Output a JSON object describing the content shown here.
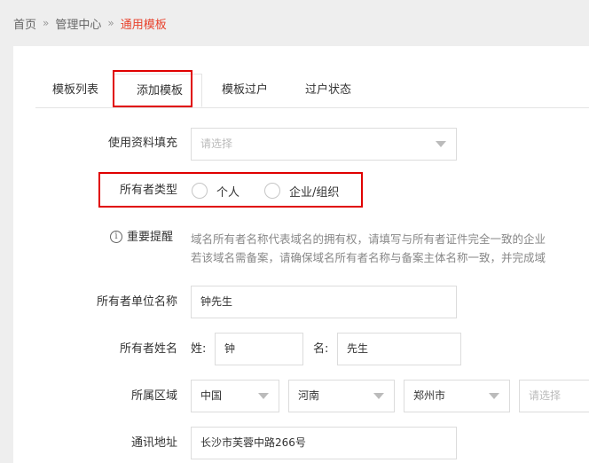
{
  "breadcrumb": {
    "home": "首页",
    "sep1": "»",
    "section": "管理中心",
    "sep2": "»",
    "current": "通用模板"
  },
  "tabs": [
    {
      "label": "模板列表"
    },
    {
      "label": "添加模板"
    },
    {
      "label": "模板过户"
    },
    {
      "label": "过户状态"
    }
  ],
  "form": {
    "fill": {
      "label": "使用资料填充",
      "placeholder": "请选择"
    },
    "owner_type": {
      "label": "所有者类型",
      "options": [
        "个人",
        "企业/组织"
      ]
    },
    "notice": {
      "label": "重要提醒",
      "icon": "info-icon",
      "lines": [
        "域名所有者名称代表域名的拥有权，请填写与所有者证件完全一致的企业",
        "若该域名需备案，请确保域名所有者名称与备案主体名称一致，并完成域"
      ]
    },
    "org_name": {
      "label": "所有者单位名称",
      "value": "钟先生"
    },
    "owner_name": {
      "label": "所有者姓名",
      "surname_label": "姓:",
      "surname": "钟",
      "given_label": "名:",
      "given": "先生"
    },
    "region": {
      "label": "所属区域",
      "country": "中国",
      "province": "河南",
      "city": "郑州市",
      "district_placeholder": "请选择"
    },
    "address": {
      "label": "通讯地址",
      "value": "长沙市芙蓉中路266号"
    }
  },
  "colors": {
    "accent": "#e8432e",
    "highlight": "#e00000"
  }
}
